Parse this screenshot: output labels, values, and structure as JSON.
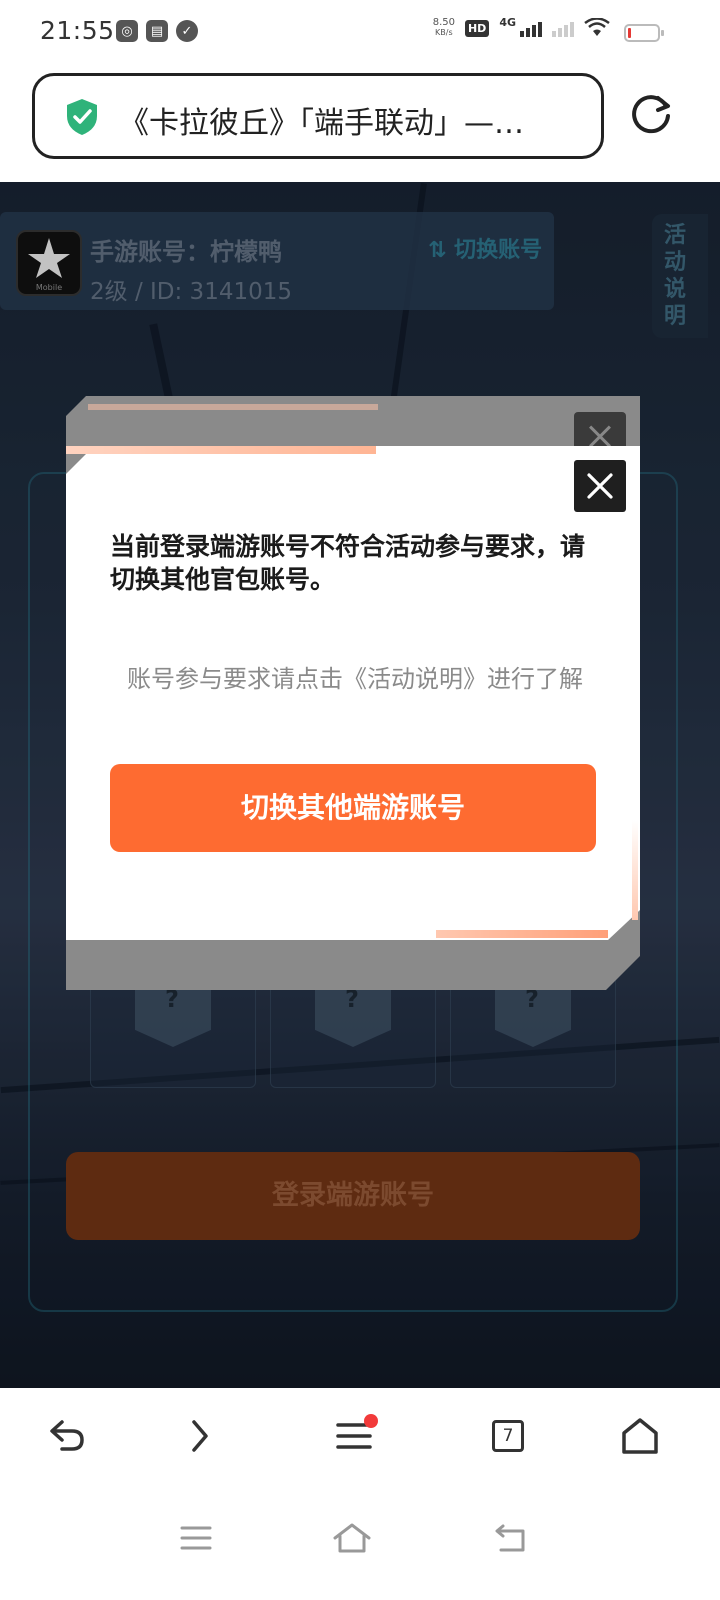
{
  "status_bar": {
    "time": "21:55",
    "net_speed_value": "8.50",
    "net_speed_unit": "KB/s",
    "hd_label": "HD",
    "network_label": "4G",
    "battery_level": 0.1
  },
  "browser": {
    "page_title": "《卡拉彼丘》「端手联动」—…",
    "reload_icon": "reload-icon",
    "secure_icon": "shield-check-icon",
    "tab_count": "7"
  },
  "account": {
    "name": "手游账号：柠檬鸭",
    "level_id": "2级 / ID: 3141015",
    "switch_label": "⇅ 切换账号",
    "logo_caption": "Mobile"
  },
  "side_tab": {
    "label": "活动说明"
  },
  "mystery_boxes": [
    "?",
    "?",
    "?"
  ],
  "login_button": "登录端游账号",
  "modal": {
    "message": "当前登录端游账号不符合活动参与要求，请切换其他官包账号。",
    "hint": "账号参与要求请点击《活动说明》进行了解",
    "button": "切换其他端游账号",
    "accent_color": "#FE6B31"
  }
}
